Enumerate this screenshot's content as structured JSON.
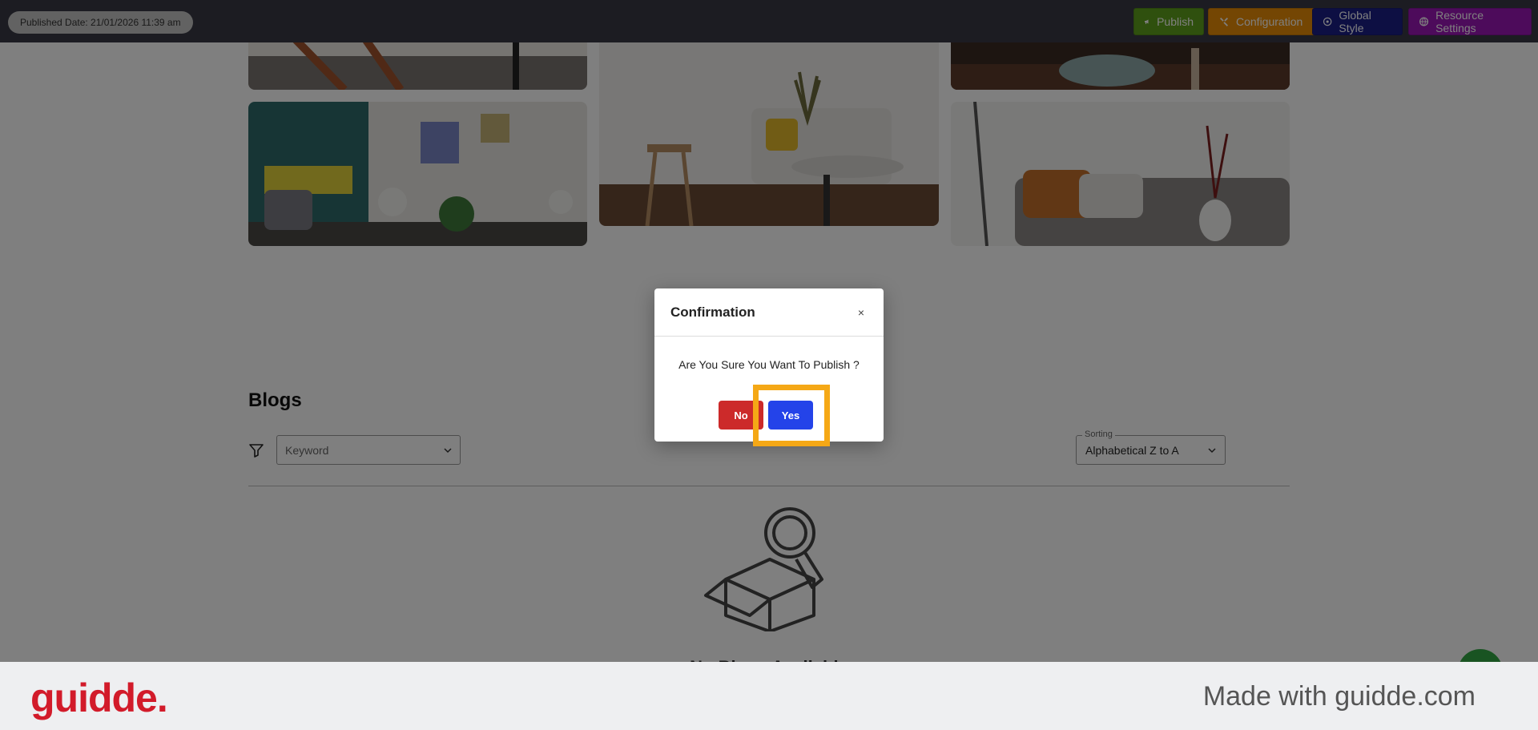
{
  "topbar": {
    "published_date": "Published Date: 21/01/2026 11:39 am",
    "buttons": [
      {
        "label": "Publish",
        "icon": "megaphone-icon"
      },
      {
        "label": "Configuration",
        "icon": "settings-icon"
      },
      {
        "label": "Global Style",
        "icon": "globe-style-icon"
      },
      {
        "label": "Resource Settings",
        "icon": "globe-icon"
      }
    ]
  },
  "blogs": {
    "title": "Blogs",
    "keyword_placeholder": "Keyword",
    "sorting_label": "Sorting",
    "sorting_value": "Alphabetical Z to A",
    "empty_text": "No Blogs Available"
  },
  "modal": {
    "title": "Confirmation",
    "close": "×",
    "message": "Are You Sure You Want To Publish ?",
    "no_label": "No",
    "yes_label": "Yes"
  },
  "footer": {
    "brand": "guidde.",
    "made_with": "Made with guidde.com"
  },
  "colors": {
    "publish": "#5fa01c",
    "configuration": "#e98d06",
    "global_style": "#1b1f87",
    "resource_settings": "#9b17b6",
    "no_button": "#cc2a2a",
    "yes_button": "#2443e9",
    "highlight": "#f5a816",
    "brand": "#d21b2a"
  }
}
